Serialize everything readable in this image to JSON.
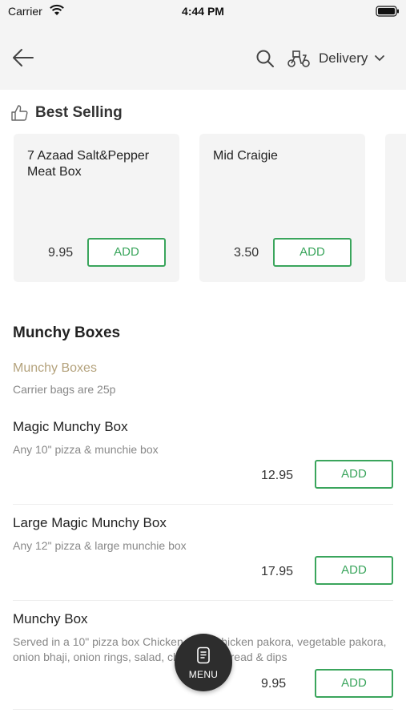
{
  "status_bar": {
    "carrier": "Carrier",
    "time": "4:44 PM"
  },
  "header": {
    "delivery_label": "Delivery"
  },
  "best_selling": {
    "title": "Best Selling",
    "items": [
      {
        "name": "7 Azaad Salt&Pepper Meat Box",
        "price": "9.95",
        "add_label": "ADD"
      },
      {
        "name": "Mid Craigie",
        "price": "3.50",
        "add_label": "ADD"
      }
    ]
  },
  "category": {
    "title": "Munchy Boxes",
    "subtitle": "Munchy Boxes",
    "note": "Carrier bags are 25p",
    "items": [
      {
        "name": "Magic Munchy Box",
        "description": "Any 10\" pizza & munchie box",
        "price": "12.95",
        "add_label": "ADD"
      },
      {
        "name": "Large Magic Munchy Box",
        "description": "Any 12\" pizza & large munchie box",
        "price": "17.95",
        "add_label": "ADD"
      },
      {
        "name": "Munchy Box",
        "description": "Served in a 10\" pizza box Chicken tikka, chicken pakora, vegetable pakora, onion bhaji, onion rings, salad, chips, pitta bread & dips",
        "price": "9.95",
        "add_label": "ADD"
      }
    ]
  },
  "menu_button": {
    "label": "MENU"
  },
  "colors": {
    "accent": "#3aa55c",
    "subtitle": "#b4a27c",
    "header_bg": "#f4f4f4",
    "fab_bg": "#2d2d2d"
  }
}
